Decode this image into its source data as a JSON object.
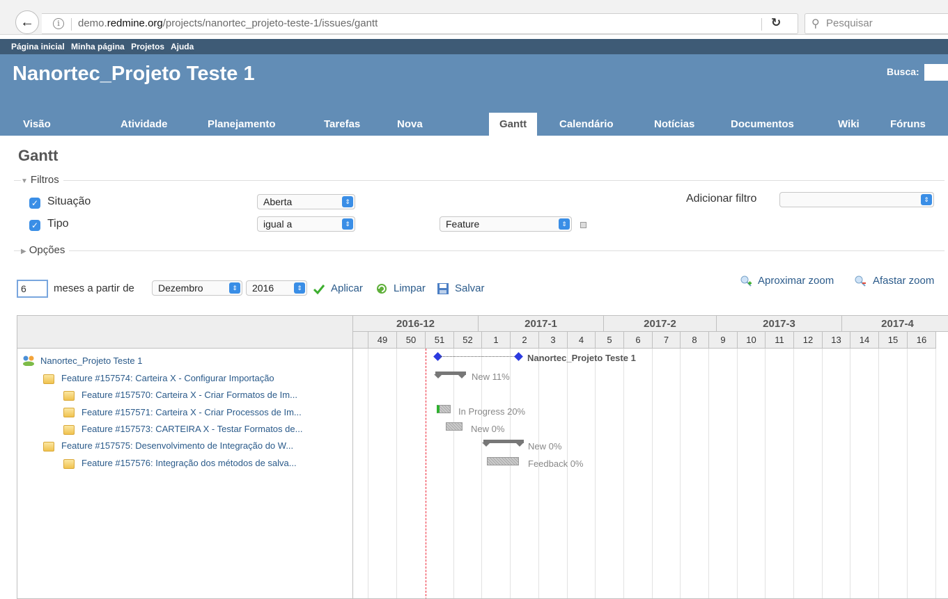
{
  "browser": {
    "url_prefix": "demo.",
    "url_domain": "redmine.org",
    "url_path": "/projects/nanortec_projeto-teste-1/issues/gantt",
    "search_placeholder": "Pesquisar"
  },
  "top_menu": [
    "Página inicial",
    "Minha página",
    "Projetos",
    "Ajuda"
  ],
  "header": {
    "project_title": "Nanortec_Projeto Teste 1",
    "search_label": "Busca:"
  },
  "main_menu": [
    "Visão geral",
    "Atividade",
    "Planejamento",
    "Tarefas",
    "Nova tarefa",
    "Gantt",
    "Calendário",
    "Notícias",
    "Documentos",
    "Wiki",
    "Fóruns"
  ],
  "selected_tab": "Gantt",
  "page_title": "Gantt",
  "filters": {
    "legend": "Filtros",
    "status_label": "Situação",
    "status_value": "Aberta",
    "tracker_label": "Tipo",
    "tracker_operator": "igual a",
    "tracker_value": "Feature",
    "add_filter_label": "Adicionar filtro",
    "add_filter_value": ""
  },
  "options_legend": "Opções",
  "period": {
    "months": "6",
    "months_label": "meses a partir de",
    "month": "Dezembro",
    "year": "2016",
    "apply": "Aplicar",
    "clear": "Limpar",
    "save": "Salvar",
    "zoom_in": "Aproximar zoom",
    "zoom_out": "Afastar zoom"
  },
  "gantt": {
    "months": [
      "2016-12",
      "2017-1",
      "2017-2",
      "2017-3",
      "2017-4"
    ],
    "weeks": [
      "",
      "49",
      "50",
      "51",
      "52",
      "1",
      "2",
      "3",
      "4",
      "5",
      "6",
      "7",
      "8",
      "9",
      "10",
      "11",
      "12",
      "13",
      "14",
      "15",
      "16"
    ],
    "rows": [
      {
        "subject": "Nanortec_Projeto Teste 1",
        "bar_label": "Nanortec_Projeto Teste 1"
      },
      {
        "subject": "Feature #157574: Carteira X - Configurar Importação",
        "bar_label": "New 11%"
      },
      {
        "subject": "Feature #157570: Carteira X - Criar Formatos de Im...",
        "bar_label": ""
      },
      {
        "subject": "Feature #157571: Carteira X - Criar Processos de Im...",
        "bar_label": "In Progress 20%"
      },
      {
        "subject": "Feature #157573: CARTEIRA X - Testar Formatos de...",
        "bar_label": "New 0%"
      },
      {
        "subject": "Feature #157575: Desenvolvimento de Integração do W...",
        "bar_label": "New 0%"
      },
      {
        "subject": "Feature #157576: Integração dos métodos de salva...",
        "bar_label": "Feedback 0%"
      }
    ]
  }
}
